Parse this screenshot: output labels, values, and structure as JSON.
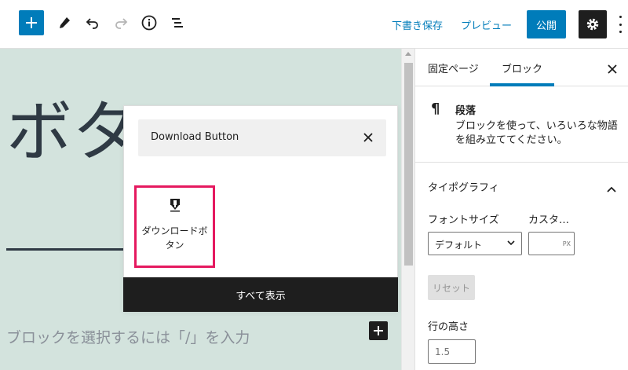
{
  "toolbar": {
    "add_block_icon": "plus-icon",
    "tools_icon": "pencil-icon",
    "undo_icon": "undo-icon",
    "redo_icon": "redo-icon",
    "info_icon": "info-icon",
    "outline_icon": "list-view-icon",
    "save_draft": "下書き保存",
    "preview": "プレビュー",
    "publish": "公開",
    "settings_icon": "gear-icon",
    "more_icon": "more-vertical-icon",
    "accent_color": "#007cba"
  },
  "canvas": {
    "title_fragment": "ボタ",
    "placeholder": "ブロックを選択するには「/」を入力",
    "background_color": "#d3e3dd"
  },
  "inserter": {
    "search_value": "Download Button",
    "result_label": "ダウンロードボタン",
    "result_icon": "download-icon",
    "show_all": "すべて表示",
    "highlight_color": "#e5195f"
  },
  "sidebar": {
    "tab_post": "固定ページ",
    "tab_block": "ブロック",
    "block_name": "段落",
    "block_icon": "pilcrow-icon",
    "block_description": "ブロックを使って、いろいろな物語を組み立ててください。",
    "typography_title": "タイポグラフィ",
    "font_size_label": "フォントサイズ",
    "custom_label": "カスタ…",
    "font_size_value": "デフォルト",
    "unit": "PX",
    "reset": "リセット",
    "line_height_label": "行の高さ",
    "line_height_value": "1.5"
  }
}
